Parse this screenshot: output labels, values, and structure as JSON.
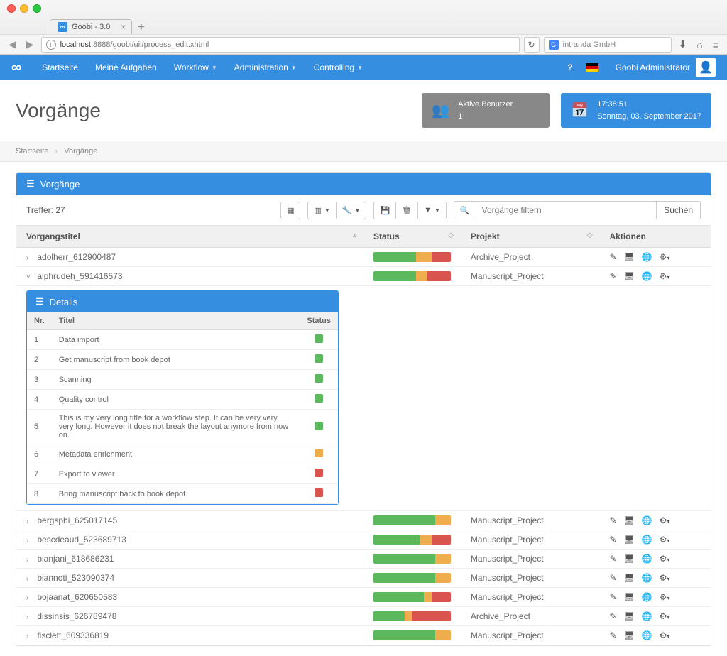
{
  "browser": {
    "tab_title": "Goobi - 3.0",
    "url_host": "localhost",
    "url_path": ":8888/goobi/uii/process_edit.xhtml",
    "search_placeholder": "intranda GmbH"
  },
  "topnav": {
    "items": [
      "Startseite",
      "Meine Aufgaben",
      "Workflow",
      "Administration",
      "Controlling"
    ],
    "user": "Goobi Administrator",
    "help": "?"
  },
  "header": {
    "title": "Vorgänge",
    "active_users_label": "Aktive Benutzer",
    "active_users_count": "1",
    "time": "17:38:51",
    "date": "Sonntag, 03. September 2017"
  },
  "breadcrumb": {
    "home": "Startseite",
    "current": "Vorgänge"
  },
  "panel": {
    "title": "Vorgänge",
    "hits_label": "Treffer:",
    "hits_count": "27",
    "filter_placeholder": "Vorgänge filtern",
    "search_button": "Suchen"
  },
  "columns": {
    "title": "Vorgangstitel",
    "status": "Status",
    "project": "Projekt",
    "actions": "Aktionen"
  },
  "details": {
    "title": "Details",
    "col_nr": "Nr.",
    "col_title": "Titel",
    "col_status": "Status",
    "steps": [
      {
        "nr": "1",
        "title": "Data import",
        "status": "green"
      },
      {
        "nr": "2",
        "title": "Get manuscript from book depot",
        "status": "green"
      },
      {
        "nr": "3",
        "title": "Scanning",
        "status": "green"
      },
      {
        "nr": "4",
        "title": "Quality control",
        "status": "green"
      },
      {
        "nr": "5",
        "title": "This is my very long title for a workflow step. It can be very very very long. However it does not break the layout anymore from now on.",
        "status": "green"
      },
      {
        "nr": "6",
        "title": "Metadata enrichment",
        "status": "orange"
      },
      {
        "nr": "7",
        "title": "Export to viewer",
        "status": "red"
      },
      {
        "nr": "8",
        "title": "Bring manuscript back to book depot",
        "status": "red"
      }
    ]
  },
  "rows": [
    {
      "expanded": false,
      "title": "adolherr_612900487",
      "project": "Archive_Project",
      "status": [
        55,
        20,
        25
      ]
    },
    {
      "expanded": true,
      "title": "alphrudeh_591416573",
      "project": "Manuscript_Project",
      "status": [
        55,
        15,
        30
      ]
    },
    {
      "expanded": false,
      "title": "bergsphi_625017145",
      "project": "Manuscript_Project",
      "status": [
        80,
        20,
        0
      ]
    },
    {
      "expanded": false,
      "title": "bescdeaud_523689713",
      "project": "Manuscript_Project",
      "status": [
        60,
        15,
        25
      ]
    },
    {
      "expanded": false,
      "title": "bianjani_618686231",
      "project": "Manuscript_Project",
      "status": [
        80,
        20,
        0
      ]
    },
    {
      "expanded": false,
      "title": "biannoti_523090374",
      "project": "Manuscript_Project",
      "status": [
        80,
        20,
        0
      ]
    },
    {
      "expanded": false,
      "title": "bojaanat_620650583",
      "project": "Manuscript_Project",
      "status": [
        65,
        10,
        25
      ]
    },
    {
      "expanded": false,
      "title": "dissinsis_626789478",
      "project": "Archive_Project",
      "status": [
        40,
        10,
        50
      ]
    },
    {
      "expanded": false,
      "title": "fisclett_609336819",
      "project": "Manuscript_Project",
      "status": [
        80,
        20,
        0
      ]
    }
  ]
}
